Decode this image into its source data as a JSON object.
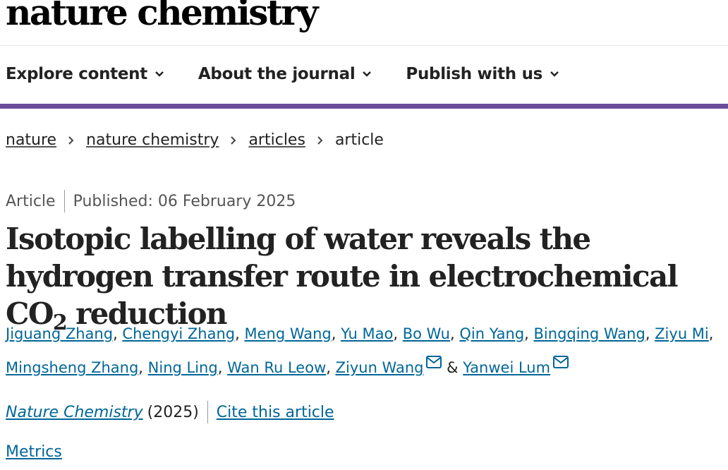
{
  "header": {
    "logo_text": "nature chemistry"
  },
  "nav": {
    "items": [
      {
        "label": "Explore content",
        "icon": "chevron-down-icon"
      },
      {
        "label": "About the journal",
        "icon": "chevron-down-icon"
      },
      {
        "label": "Publish with us",
        "icon": "chevron-down-icon"
      }
    ],
    "accent_color": "#6b4c9a"
  },
  "breadcrumb": {
    "items": [
      "nature",
      "nature chemistry",
      "articles"
    ],
    "current": "article"
  },
  "article": {
    "type": "Article",
    "published": "Published: 06 February 2025",
    "title_part1": "Isotopic labelling of water reveals the hydrogen transfer route in electrochemical CO",
    "title_sub": "2",
    "title_part2": " reduction",
    "authors": [
      "Jiguang Zhang",
      "Chengyi Zhang",
      "Meng Wang",
      "Yu Mao",
      "Bo Wu",
      "Qin Yang",
      "Bingqing Wang",
      "Ziyu Mi",
      "Mingsheng Zhang",
      "Ning Ling",
      "Wan Ru Leow",
      "Ziyun Wang",
      "Yanwei Lum"
    ],
    "ampersand": "&",
    "journal": "Nature Chemistry",
    "year": "(2025)",
    "cite_label": "Cite this article",
    "metrics_label": "Metrics",
    "link_color": "#006699"
  }
}
